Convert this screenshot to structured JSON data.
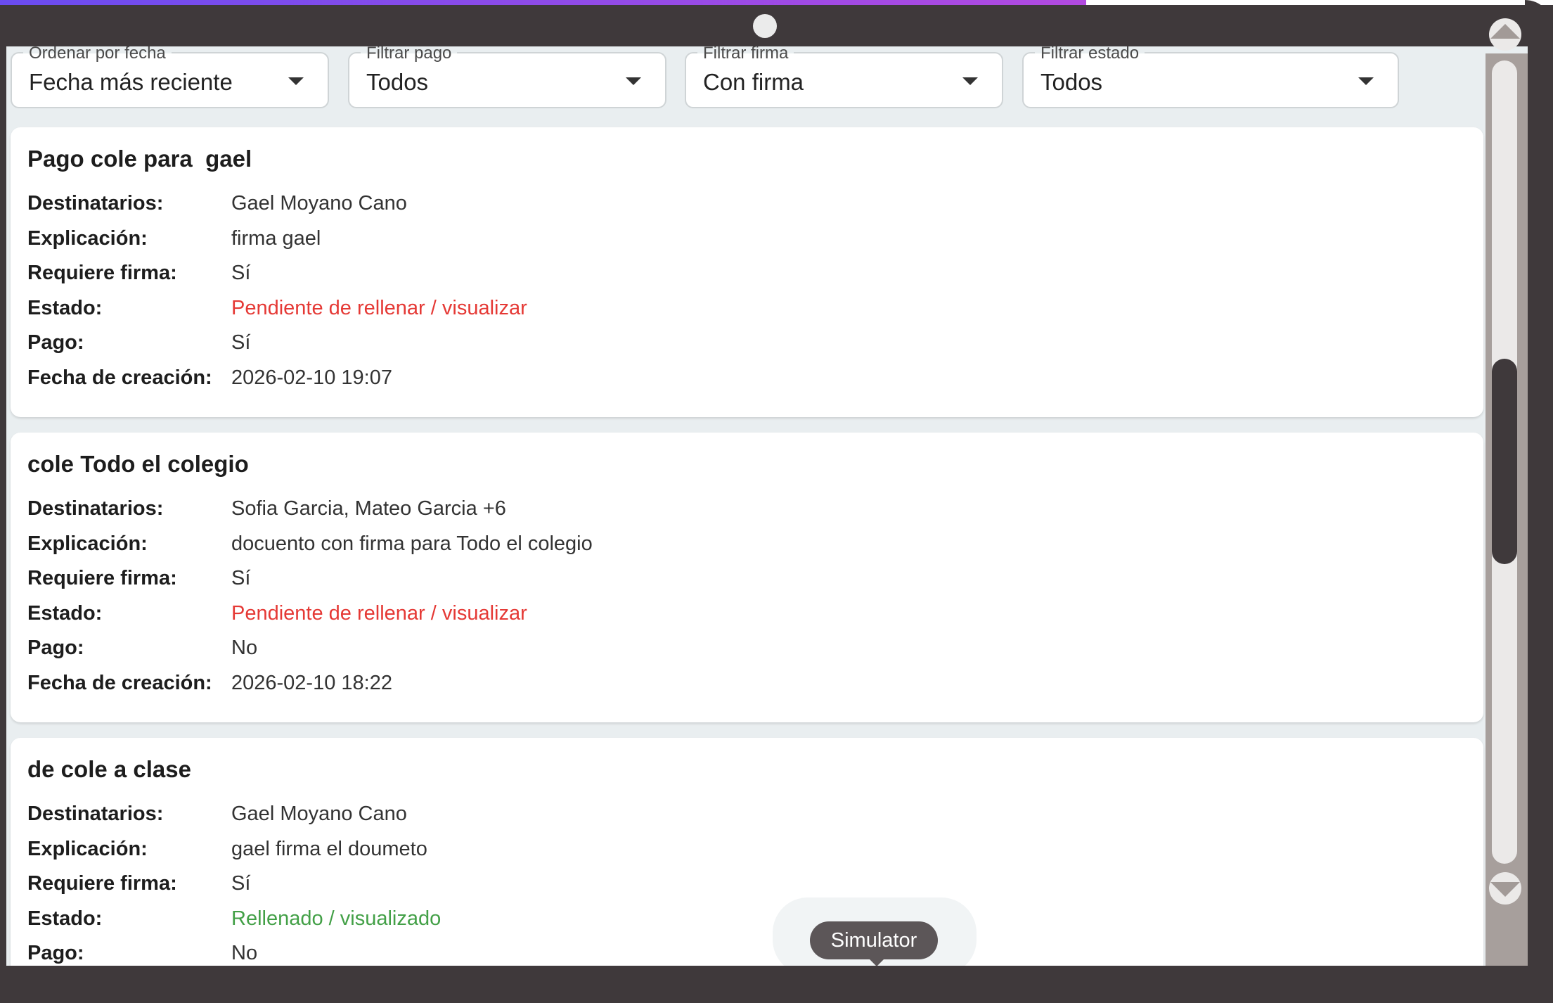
{
  "colors": {
    "pending": "#e53935",
    "done": "#43a047",
    "bezel": "#3f393b",
    "accent": "#8a4be8"
  },
  "filters": [
    {
      "label": "Ordenar por fecha",
      "value": "Fecha más reciente"
    },
    {
      "label": "Filtrar pago",
      "value": "Todos"
    },
    {
      "label": "Filtrar firma",
      "value": "Con firma"
    },
    {
      "label": "Filtrar estado",
      "value": "Todos"
    }
  ],
  "field_labels": {
    "recipients": "Destinatarios:",
    "explanation": "Explicación:",
    "signature": "Requiere firma:",
    "status": "Estado:",
    "payment": "Pago:",
    "created": "Fecha de creación:"
  },
  "cards": [
    {
      "title": "Pago cole para  gael",
      "recipients": "Gael Moyano Cano",
      "explanation": "firma gael",
      "signature": "Sí",
      "status": "Pendiente de rellenar / visualizar",
      "payment": "Sí",
      "created": "2026-02-10 19:07"
    },
    {
      "title": "cole Todo el colegio",
      "recipients": "Sofia Garcia, Mateo Garcia +6",
      "explanation": "docuento con firma para Todo el colegio",
      "signature": "Sí",
      "status": "Pendiente de rellenar / visualizar",
      "payment": "No",
      "created": "2026-02-10 18:22"
    },
    {
      "title": "de cole a clase",
      "recipients": "Gael Moyano Cano",
      "explanation": "gael firma el doumeto",
      "signature": "Sí",
      "status": "Rellenado / visualizado",
      "payment": "No"
    }
  ],
  "tooltip": "Simulator"
}
